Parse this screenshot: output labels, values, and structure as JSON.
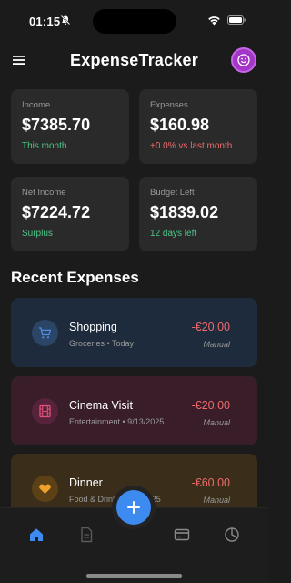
{
  "status_bar": {
    "time": "01:15"
  },
  "header": {
    "title": "ExpenseTracker"
  },
  "summary_cards": [
    {
      "label": "Income",
      "value": "$7385.70",
      "sub": "This month"
    },
    {
      "label": "Expenses",
      "value": "$160.98",
      "sub": "+0.0% vs last month"
    },
    {
      "label": "Net Income",
      "value": "$7224.72",
      "sub": "Surplus"
    },
    {
      "label": "Budget Left",
      "value": "$1839.02",
      "sub": "12 days left"
    }
  ],
  "recent": {
    "title": "Recent Expenses",
    "items": [
      {
        "name": "Shopping",
        "meta": "Groceries • Today",
        "amount": "-€20.00",
        "source": "Manual",
        "icon": "shopping-cart-icon",
        "bg": "#1e2b3c",
        "icon_bg": "#2b4566",
        "icon_color": "#4f8de0"
      },
      {
        "name": "Cinema Visit",
        "meta": "Entertainment • 9/13/2025",
        "amount": "-€20.00",
        "source": "Manual",
        "icon": "film-icon",
        "bg": "#391e2a",
        "icon_bg": "#57233a",
        "icon_color": "#e0507a"
      },
      {
        "name": "Dinner",
        "meta": "Food & Drink • 9/13/2025",
        "amount": "-€60.00",
        "source": "Manual",
        "icon": "heart-icon",
        "bg": "#3a2e1b",
        "icon_bg": "#5c4117",
        "icon_color": "#f0a12c"
      }
    ]
  },
  "nav": {
    "items": [
      {
        "icon": "home-icon",
        "active": true
      },
      {
        "icon": "document-icon",
        "active": false
      },
      {
        "icon": "add-icon",
        "active": false
      },
      {
        "icon": "credit-card-icon",
        "active": false
      },
      {
        "icon": "pie-chart-icon",
        "active": false
      }
    ]
  },
  "colors": {
    "accent": "#3d8af0",
    "income": "#4ec98a",
    "expense": "#ef6b6b",
    "avatar": "#a437c7"
  }
}
